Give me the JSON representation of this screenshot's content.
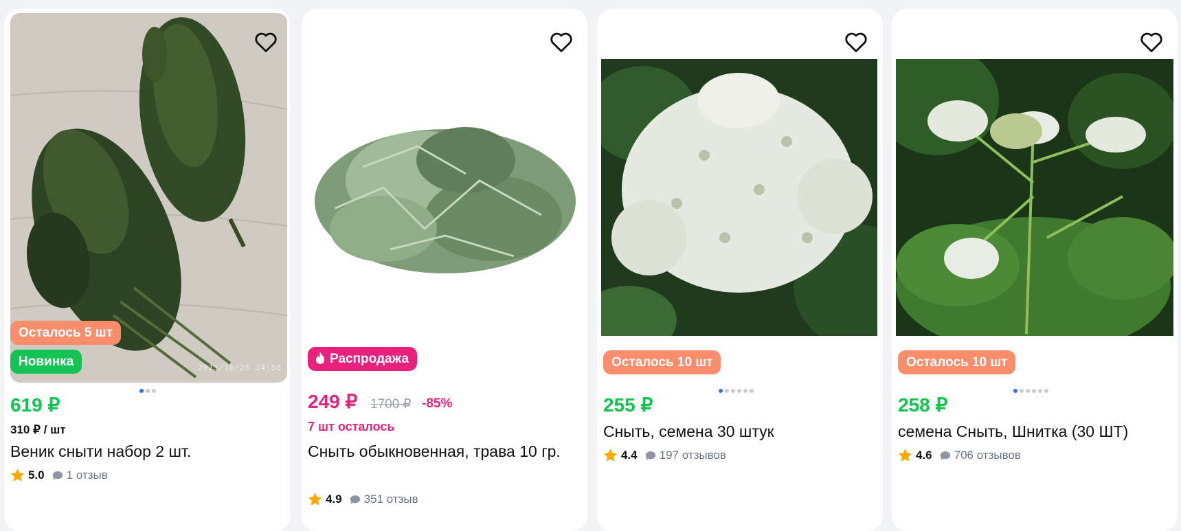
{
  "products": [
    {
      "title": "Веник сныти набор 2 шт.",
      "price": "619 ₽",
      "unit_price": "310 ₽ / шт",
      "badges": [
        "Осталось 5 шт",
        "Новинка"
      ],
      "photo_timestamp": "2023/10/25 14:50",
      "rating": "5.0",
      "reviews": "1 отзыв",
      "image_dots": 3,
      "active_dot": 1
    },
    {
      "title": "Сныть обыкновенная, трава 10 гр.",
      "price": "249 ₽",
      "old_price": "1700 ₽",
      "discount": "-85%",
      "stock_left": "7 шт осталось",
      "badges": [
        "Распродажа"
      ],
      "rating": "4.9",
      "reviews": "351 отзыв"
    },
    {
      "title": "Сныть, семена 30 штук",
      "price": "255 ₽",
      "badges": [
        "Осталось 10 шт"
      ],
      "rating": "4.4",
      "reviews": "197 отзывов",
      "image_dots": 6,
      "active_dot": 1
    },
    {
      "title": "семена Сныть, Шнитка (30 ШТ)",
      "price": "258 ₽",
      "badges": [
        "Осталось 10 шт"
      ],
      "rating": "4.6",
      "reviews": "706 отзывов",
      "image_dots": 6,
      "active_dot": 1
    }
  ],
  "icons": {
    "favorite": "heart-outline-icon",
    "sale": "fire-icon",
    "rating": "star-icon",
    "reviews": "comment-bubble-icon"
  },
  "colors": {
    "price_green": "#10c44c",
    "sale_pink": "#e8217c",
    "stock_badge": "#f98d6c",
    "new_badge": "#13c455",
    "star": "#ffa800",
    "active_dot": "#2f6ef6"
  }
}
